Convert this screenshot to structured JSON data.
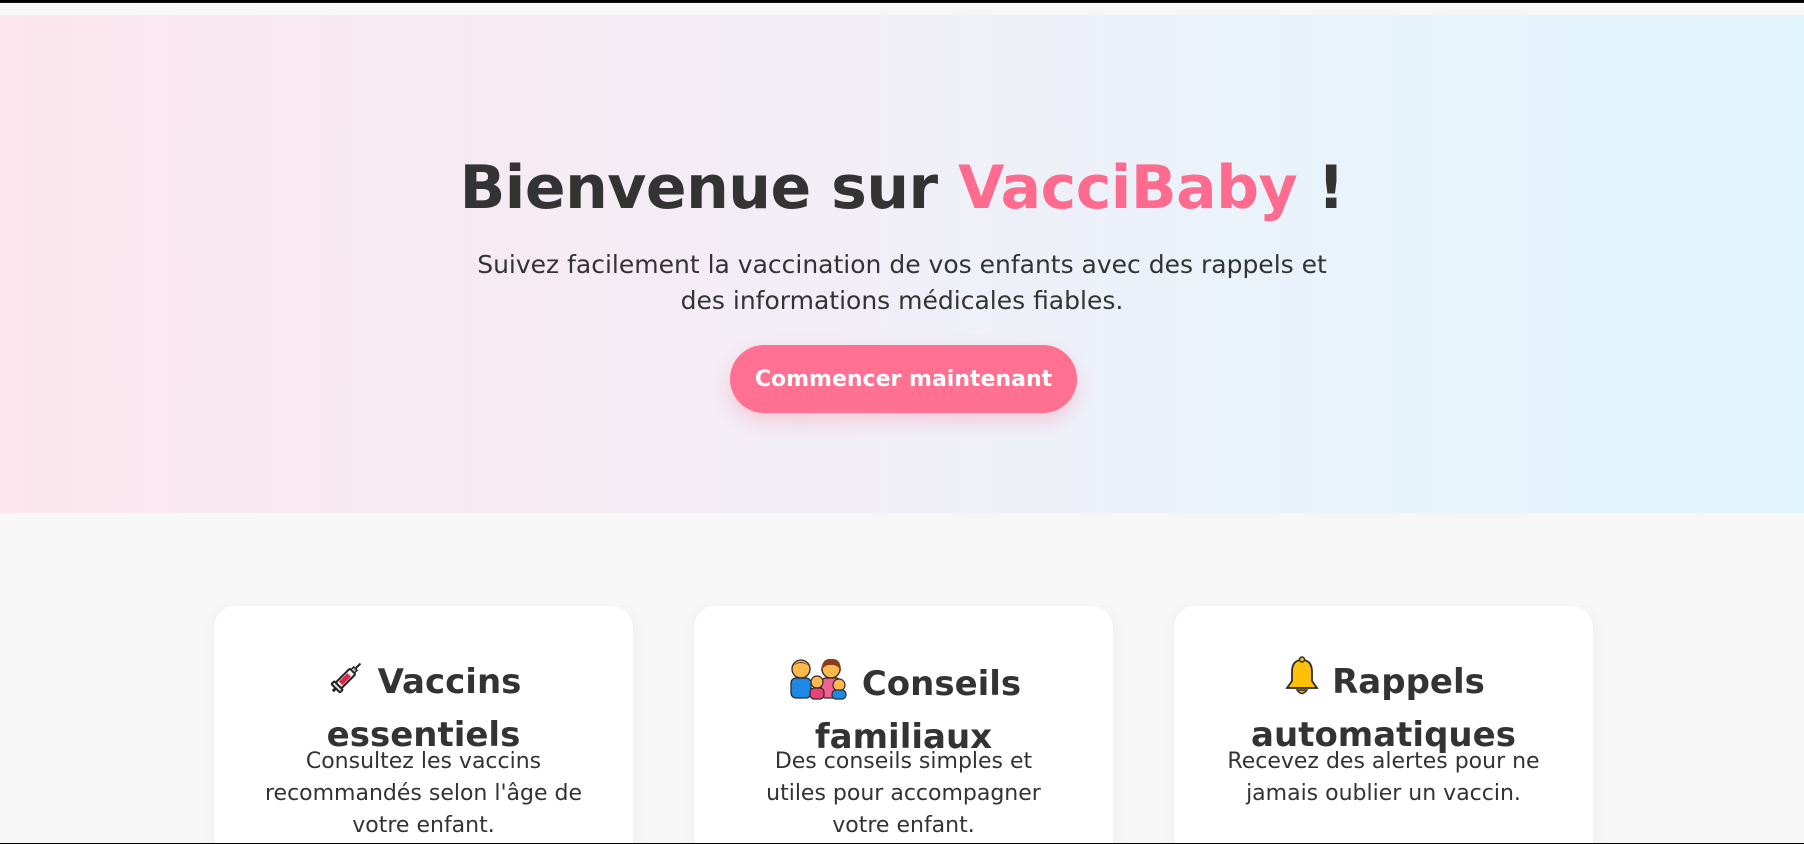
{
  "hero": {
    "title_prefix": "Bienvenue sur ",
    "brand": "VacciBaby",
    "title_suffix": " !",
    "subtitle": "Suivez facilement la vaccination de vos enfants avec des rappels et des informations médicales fiables.",
    "cta_label": "Commencer maintenant"
  },
  "features": [
    {
      "icon": "syringe-icon",
      "title": "Vaccins essentiels",
      "description": "Consultez les vaccins recommandés selon l'âge de votre enfant."
    },
    {
      "icon": "family-icon",
      "title": "Conseils familiaux",
      "description": "Des conseils simples et utiles pour accompagner votre enfant."
    },
    {
      "icon": "bell-icon",
      "title": "Rappels automatiques",
      "description": "Recevez des alertes pour ne jamais oublier un vaccin."
    }
  ],
  "colors": {
    "brand": "#ff6b8f",
    "button": "#ff7091",
    "text": "#333333"
  }
}
